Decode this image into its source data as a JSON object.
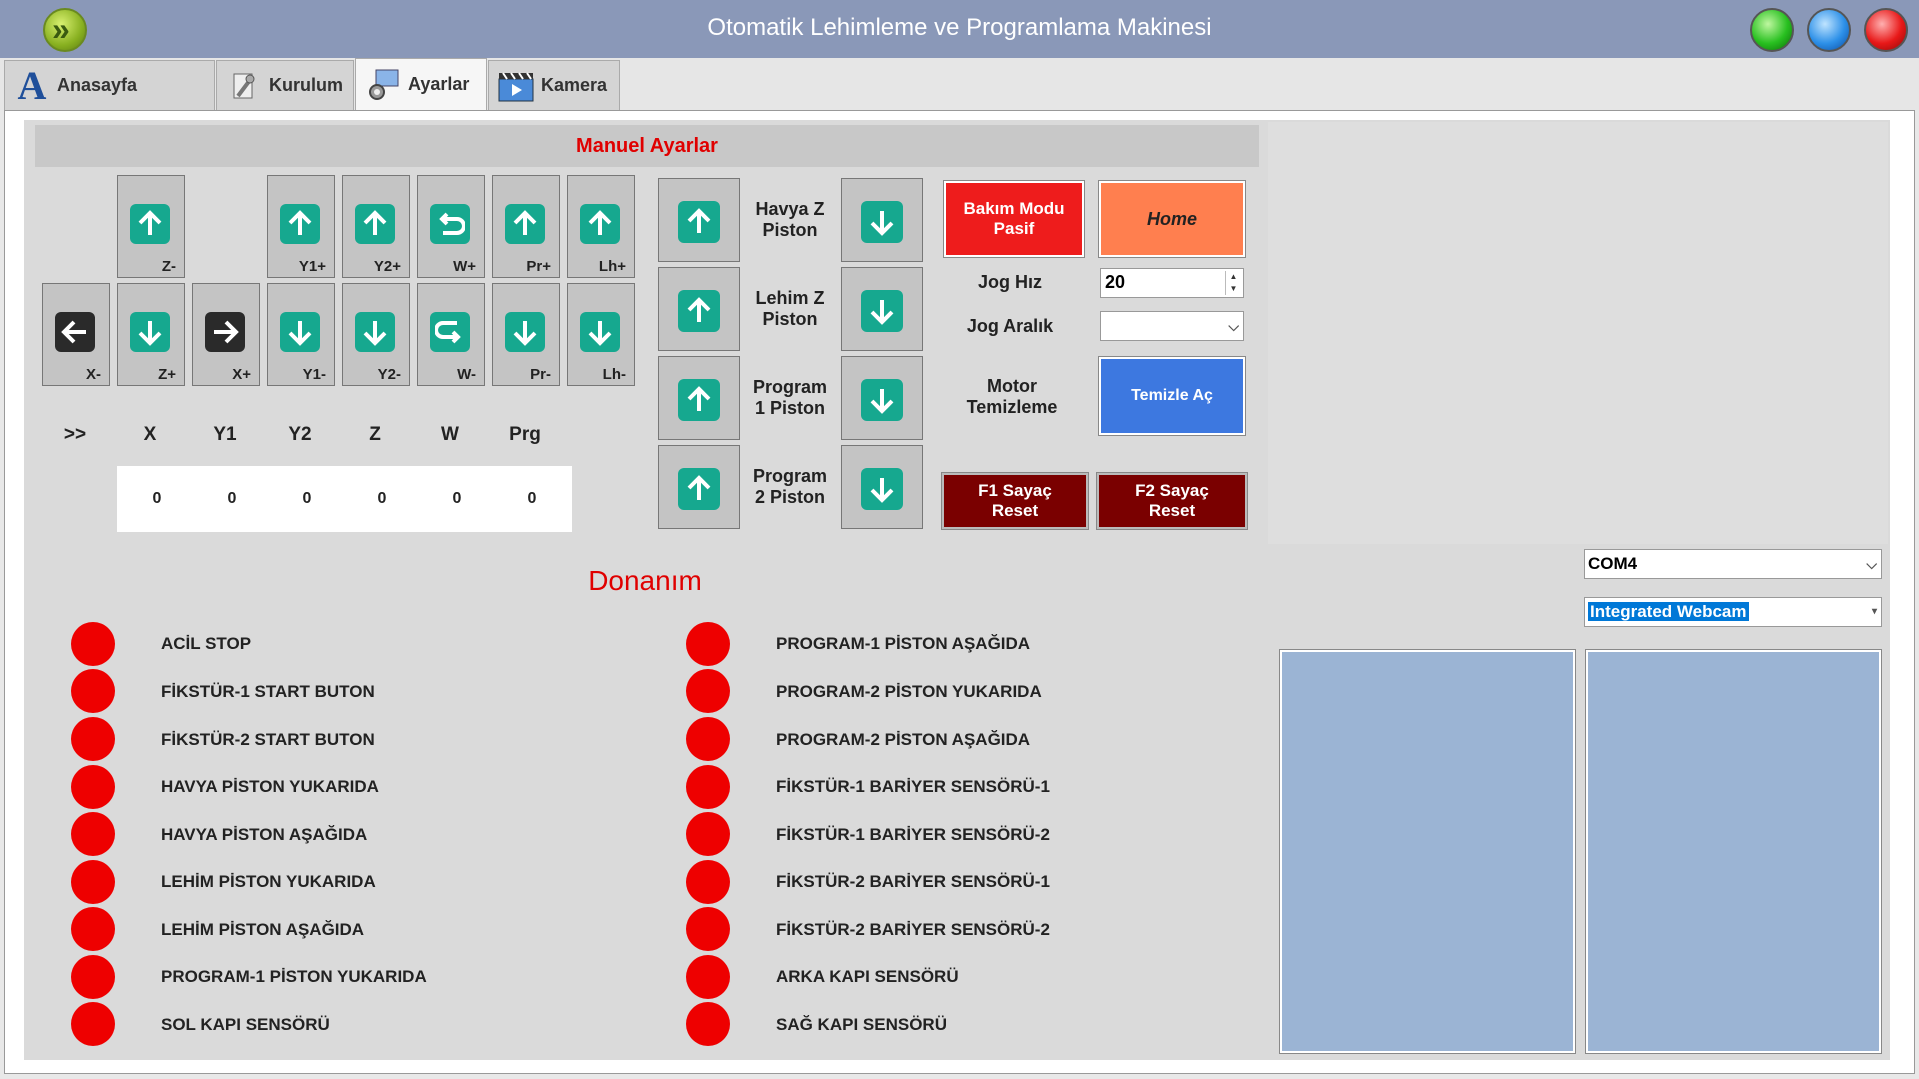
{
  "window": {
    "title": "Otomatik Lehimleme ve Programlama Makinesi"
  },
  "tabs": [
    {
      "label": "Anasayfa"
    },
    {
      "label": "Kurulum"
    },
    {
      "label": "Ayarlar"
    },
    {
      "label": "Kamera"
    }
  ],
  "manual": {
    "title": "Manuel Ayarlar",
    "jog_top": [
      "Z-",
      "Y1+",
      "Y2+",
      "W+",
      "Pr+",
      "Lh+"
    ],
    "jog_bottom": [
      "X-",
      "Z+",
      "X+",
      "Y1-",
      "Y2-",
      "W-",
      "Pr-",
      "Lh-"
    ],
    "axes": {
      "headers": [
        ">>",
        "X",
        "Y1",
        "Y2",
        "Z",
        "W",
        "Prg"
      ],
      "values": [
        "0",
        "0",
        "0",
        "0",
        "0",
        "0"
      ]
    },
    "pistons": [
      {
        "line1": "Havya Z",
        "line2": "Piston"
      },
      {
        "line1": "Lehim Z",
        "line2": "Piston"
      },
      {
        "line1": "Program",
        "line2": "1 Piston"
      },
      {
        "line1": "Program",
        "line2": "2 Piston"
      }
    ],
    "bakim_line1": "Bakım Modu",
    "bakim_line2": "Pasif",
    "home": "Home",
    "jog_hiz_label": "Jog Hız",
    "jog_hiz_value": "20",
    "jog_aralik_label": "Jog Aralık",
    "jog_aralik_value": "",
    "motor_line1": "Motor",
    "motor_line2": "Temizleme",
    "temizle": "Temizle Aç",
    "f1_line1": "F1 Sayaç",
    "f1_line2": "Reset",
    "f2_line1": "F2 Sayaç",
    "f2_line2": "Reset"
  },
  "hardware": {
    "title": "Donanım",
    "left": [
      "ACİL STOP",
      "FİKSTÜR-1 START BUTON",
      "FİKSTÜR-2 START BUTON",
      "HAVYA PİSTON YUKARIDA",
      "HAVYA PİSTON AŞAĞIDA",
      "LEHİM PİSTON YUKARIDA",
      "LEHİM PİSTON AŞAĞIDA",
      "PROGRAM-1 PİSTON YUKARIDA",
      "SOL KAPI SENSÖRÜ"
    ],
    "right": [
      "PROGRAM-1 PİSTON AŞAĞIDA",
      "PROGRAM-2 PİSTON YUKARIDA",
      "PROGRAM-2 PİSTON AŞAĞIDA",
      "FİKSTÜR-1 BARİYER SENSÖRÜ-1",
      "FİKSTÜR-1 BARİYER SENSÖRÜ-2",
      "FİKSTÜR-2 BARİYER SENSÖRÜ-1",
      "FİKSTÜR-2 BARİYER SENSÖRÜ-2",
      "ARKA KAPI SENSÖRÜ",
      "SAĞ KAPI SENSÖRÜ"
    ],
    "indicator_color": "#ee0000"
  },
  "camera": {
    "com_port": "COM4",
    "webcam": "Integrated Webcam"
  },
  "colors": {
    "accent_teal": "#16a88f",
    "red_button": "#ee1c1c",
    "orange_button": "#ff7f4f",
    "blue_button": "#3d78e0",
    "dark_red_button": "#7a0000"
  }
}
